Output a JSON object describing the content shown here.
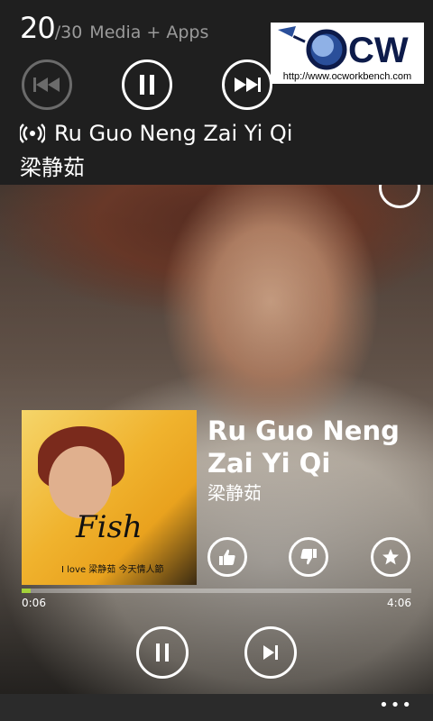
{
  "volume": {
    "level": "20",
    "max": "/30",
    "target": "Media + Apps"
  },
  "now_playing": {
    "title": "Ru Guo Neng Zai Yi Qi",
    "artist": "梁静茹"
  },
  "logo": {
    "text": "OCW",
    "url": "http://www.ocworkbench.com"
  },
  "player": {
    "title": "Ru Guo Neng Zai Yi Qi",
    "artist": "梁静茹",
    "album_art": {
      "script_text": "Fish",
      "caption": "I love 梁静茹 今天情人節"
    },
    "position": "0:06",
    "duration": "4:06",
    "progress": 0.024
  },
  "colors": {
    "accent": "#a4d23a",
    "panel": "#1f1f1f",
    "appbar": "#2b2b2b"
  },
  "appbar": {
    "more": "•••"
  }
}
